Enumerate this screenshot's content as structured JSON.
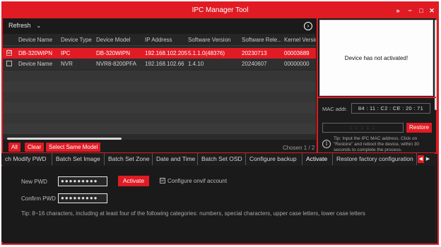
{
  "window": {
    "title": "IPC Manager Tool"
  },
  "title_controls": {
    "collapse": "»",
    "minimize": "−",
    "maximize": "□",
    "close": "✕"
  },
  "toolbar": {
    "refresh_label": "Refresh",
    "refresh_chevron": "⌄",
    "nav_icon": "›"
  },
  "table": {
    "headers": [
      "Device Name",
      "Device Type",
      "Device Model",
      "IP Address",
      "Software Version",
      "Software Rele...",
      "Kernel Versio"
    ],
    "rows": [
      {
        "checked": true,
        "check_glyph": "☑",
        "cells": [
          "DB-320WIPN",
          "IPC",
          "DB-320WIPN",
          "192.168.102.205",
          "5.1.1.0(48376)",
          "20230713",
          "00003689"
        ]
      },
      {
        "checked": false,
        "check_glyph": "",
        "cells": [
          "Device Name",
          "NVR",
          "NVR8-8200PFA",
          "192.168.102.66",
          "1.4.10",
          "20240607",
          "00000000"
        ]
      }
    ]
  },
  "actions": {
    "all": "All",
    "clear": "Clear",
    "select_same_model": "Select Same Model",
    "chosen": "Chosen 1 / 2"
  },
  "right_panel": {
    "preview_message": "Device has not activated!",
    "mac_label": "MAC addr.",
    "mac_value": "84 : 11 : C2 : CE : 20 : 71",
    "mac_input": ":   :   :   :   :",
    "restore_label": "Restore",
    "info_icon": "i",
    "tip": "Tip: Input the IPC MAC address. Click on \"Restore\" and reboot the device, within 30 seconds to complete the process."
  },
  "tabs": {
    "items": [
      "ch Modify PWD",
      "Batch Set Image",
      "Batch Set Zone",
      "Date and Time",
      "Batch Set OSD",
      "Configure backup",
      "Activate",
      "Restore factory configuration"
    ],
    "active": "Activate",
    "arrow_left": "◀",
    "arrow_right": "▶"
  },
  "activate_form": {
    "new_pwd_label": "New PWD",
    "new_pwd_value": "●●●●●●●●●",
    "confirm_pwd_label": "Confirm PWD",
    "confirm_pwd_value": "●●●●●●●●●",
    "activate_label": "Activate",
    "onvif_check_glyph": "☑",
    "onvif_label": "Configure onvif account",
    "tip": "Tip: 8~16 characters, including at least four of the following categories: numbers, special characters, upper case letters, lower case letters"
  },
  "colors": {
    "accent": "#e01b24",
    "background": "#1e1e1e",
    "row": "#2f2f2f"
  }
}
